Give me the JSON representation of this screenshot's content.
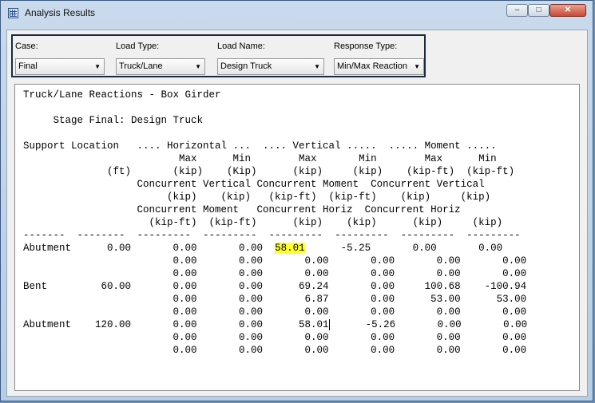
{
  "window": {
    "title": "Analysis Results",
    "minimize": "–",
    "maximize": "□",
    "close": "✕"
  },
  "controls": {
    "case": {
      "label": "Case:",
      "value": "Final"
    },
    "load_type": {
      "label": "Load Type:",
      "value": "Truck/Lane"
    },
    "load_name": {
      "label": "Load Name:",
      "value": "Design Truck"
    },
    "response_type": {
      "label": "Response Type:",
      "value": "Min/Max Reaction"
    }
  },
  "report": {
    "title": "Truck/Lane Reactions - Box Girder",
    "stage": "Stage Final: Design Truck",
    "headers": [
      "Support Location   .... Horizontal ...  .... Vertical .....  ..... Moment .....",
      "                          Max      Min        Max       Min        Max      Min",
      "              (ft)       (kip)    (Kip)      (kip)     (kip)    (kip-ft)  (kip-ft)",
      "                   Concurrent Vertical Concurrent Moment  Concurrent Vertical",
      "                        (kip)    (kip)   (kip-ft)  (kip-ft)    (kip)     (kip)",
      "                   Concurrent Moment   Concurrent Horiz  Concurrent Horiz",
      "                     (kip-ft)  (kip-ft)      (kip)    (kip)      (kip)     (kip)",
      "-------  --------  ---------  ---------  ---------  ---------  ---------  ---------"
    ],
    "rows_before": [
      "Abutment      0.00       0.00       0.00  "
    ],
    "highlight_value": "58.01",
    "row1_tail": "      -5.25       0.00       0.00",
    "rows_after": [
      "                         0.00       0.00       0.00       0.00       0.00       0.00",
      "                         0.00       0.00       0.00       0.00       0.00       0.00",
      "Bent         60.00       0.00       0.00      69.24       0.00     100.68    -100.94",
      "                         0.00       0.00       6.87       0.00      53.00      53.00",
      "                         0.00       0.00       0.00       0.00       0.00       0.00"
    ],
    "row_cursor_head": "Abutment    120.00       0.00       0.00      58.01",
    "row_cursor_tail": "      -5.26       0.00       0.00",
    "rows_end": [
      "                         0.00       0.00       0.00       0.00       0.00       0.00",
      "                         0.00       0.00       0.00       0.00       0.00       0.00"
    ]
  },
  "colors": {
    "highlight": "#ffff33",
    "frame": "#b7cde4"
  }
}
